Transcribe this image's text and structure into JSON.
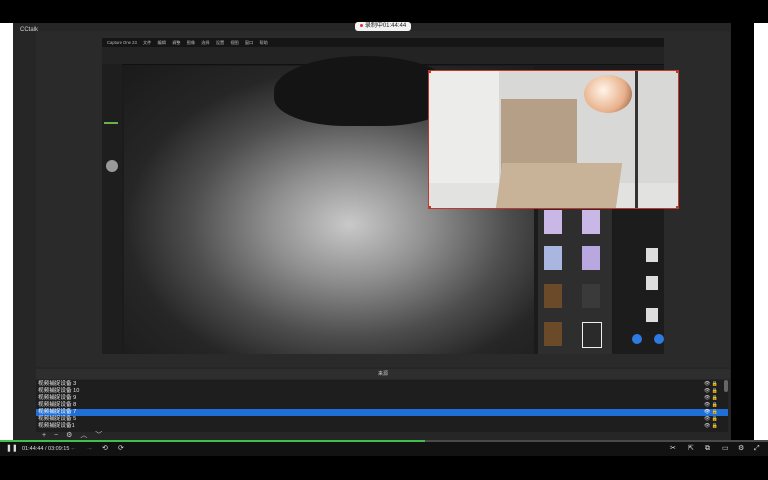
{
  "app": {
    "brand": "CCtalk"
  },
  "recording": {
    "label": "录制中01:44:44"
  },
  "capture_window": {
    "app_title": "Capture One 23",
    "menu": [
      "文件",
      "编辑",
      "调整",
      "图像",
      "选择",
      "设置",
      "视图",
      "窗口",
      "帮助"
    ]
  },
  "sources": {
    "header": "来源",
    "items": [
      {
        "label": "视频捕捉设备 3",
        "selected": false
      },
      {
        "label": "视频捕捉设备 10",
        "selected": false
      },
      {
        "label": "视频捕捉设备 9",
        "selected": false
      },
      {
        "label": "视频捕捉设备 8",
        "selected": false
      },
      {
        "label": "视频捕捉设备 7",
        "selected": true
      },
      {
        "label": "视频捕捉设备 5",
        "selected": false
      },
      {
        "label": "视频捕捉设备1",
        "selected": false
      }
    ],
    "tools": [
      "+",
      "−",
      "⚙",
      "︿",
      "﹀"
    ]
  },
  "player": {
    "time_current": "01:44:44",
    "time_total": "03:09:15",
    "progress": 0.553,
    "icons": [
      "pause-icon",
      "prev-icon",
      "next-icon",
      "rewind-15-icon",
      "forward-15-icon",
      "scissors-icon",
      "share-icon",
      "pip-icon",
      "subtitle-icon",
      "settings-icon",
      "fullscreen-icon"
    ]
  },
  "colors": {
    "selection": "#1f6fd6",
    "progress": "#3fbf4f",
    "record": "#e03030",
    "cam_border": "#c0392b"
  }
}
